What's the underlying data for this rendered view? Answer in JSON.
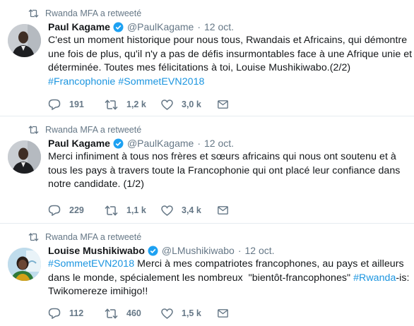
{
  "tweets": [
    {
      "retweet_label": "Rwanda MFA a retweeté",
      "author": {
        "name": "Paul Kagame",
        "handle": "@PaulKagame",
        "avatar": "avatar-paul-kagame"
      },
      "separator": "·",
      "time": "12 oct.",
      "lines": [
        [
          {
            "t": "C'est un moment historique pour nous tous, Rwandais et Africains, qui démontre"
          }
        ],
        [
          {
            "t": "une fois de plus, qu'il n'y a pas de défis insurmontables face à une Afrique unie et"
          }
        ],
        [
          {
            "t": "déterminée. Toutes mes félicitations à toi, Louise Mushikiwabo.(2/2)"
          }
        ],
        [
          {
            "t": "#Francophonie",
            "tag": true
          },
          {
            "t": " "
          },
          {
            "t": "#SommetEVN2018",
            "tag": true
          }
        ]
      ],
      "stats": {
        "replies": "191",
        "retweets": "1,2 k",
        "likes": "3,0 k"
      }
    },
    {
      "retweet_label": "Rwanda MFA a retweeté",
      "author": {
        "name": "Paul Kagame",
        "handle": "@PaulKagame",
        "avatar": "avatar-paul-kagame"
      },
      "separator": "·",
      "time": "12 oct.",
      "lines": [
        [
          {
            "t": "Merci infiniment à tous nos frères et sœurs africains qui nous ont soutenu et à"
          }
        ],
        [
          {
            "t": "tous les pays à travers toute la Francophonie qui ont placé leur confiance dans"
          }
        ],
        [
          {
            "t": "notre candidate. (1/2)"
          }
        ]
      ],
      "stats": {
        "replies": "229",
        "retweets": "1,1 k",
        "likes": "3,4 k"
      }
    },
    {
      "retweet_label": "Rwanda MFA a retweeté",
      "author": {
        "name": "Louise Mushikiwabo",
        "handle": "@LMushikiwabo",
        "avatar": "avatar-louise-mushikiwabo"
      },
      "separator": "·",
      "time": "12 oct.",
      "lines": [
        [
          {
            "t": "#SommetEVN2018",
            "tag": true
          },
          {
            "t": " Merci à mes compatriotes francophones, au pays et ailleurs"
          }
        ],
        [
          {
            "t": "dans le monde, spécialement les nombreux  \"bientôt-francophones\" "
          },
          {
            "t": "#Rwanda",
            "tag": true
          },
          {
            "t": "-is:"
          }
        ],
        [
          {
            "t": "Twikomereze imihigo!!"
          }
        ]
      ],
      "stats": {
        "replies": "112",
        "retweets": "460",
        "likes": "1,5 k"
      }
    }
  ],
  "icons": {
    "retweet": "retweet-icon",
    "verified": "verified-badge-icon",
    "reply": "reply-icon",
    "like": "heart-icon",
    "dm": "envelope-icon"
  },
  "colors": {
    "link": "#1b95e0",
    "muted": "#657786",
    "text": "#14171a",
    "verified": "#1da1f2",
    "divider": "#e6ecf0"
  }
}
